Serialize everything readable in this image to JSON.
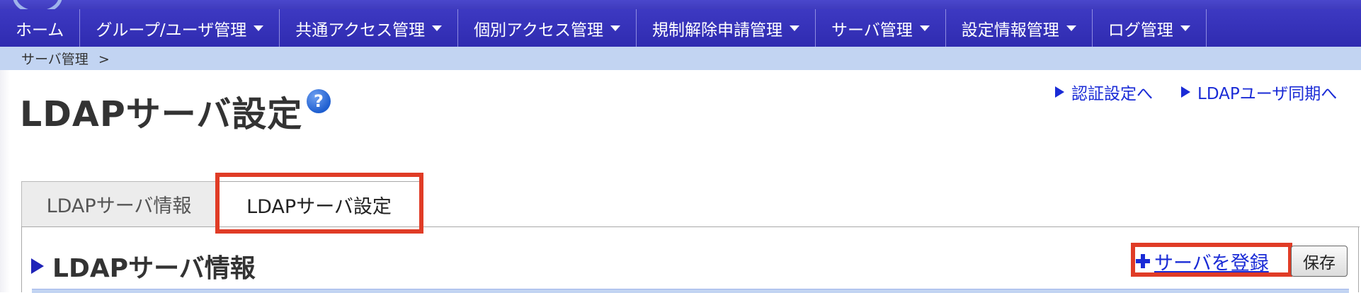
{
  "nav": {
    "items": [
      {
        "label": "ホーム",
        "has_menu": false
      },
      {
        "label": "グループ/ユーザ管理",
        "has_menu": true
      },
      {
        "label": "共通アクセス管理",
        "has_menu": true
      },
      {
        "label": "個別アクセス管理",
        "has_menu": true
      },
      {
        "label": "規制解除申請管理",
        "has_menu": true
      },
      {
        "label": "サーバ管理",
        "has_menu": true
      },
      {
        "label": "設定情報管理",
        "has_menu": true
      },
      {
        "label": "ログ管理",
        "has_menu": true
      }
    ]
  },
  "breadcrumb": {
    "label": "サーバ管理",
    "separator": ">"
  },
  "page": {
    "title": "LDAPサーバ設定",
    "help_icon_glyph": "?"
  },
  "links": {
    "auth_settings": "認証設定へ",
    "ldap_user_sync": "LDAPユーザ同期へ"
  },
  "tabs": [
    {
      "label": "LDAPサーバ情報",
      "active": false
    },
    {
      "label": "LDAPサーバ設定",
      "active": true
    }
  ],
  "section": {
    "title": "LDAPサーバ情報",
    "register_label": "サーバを登録",
    "save_label": "保存"
  },
  "colors": {
    "nav_bg": "#3d39c2",
    "breadcrumb_bg": "#c2d4f2",
    "link": "#1a2bd6",
    "highlight": "#e03c26"
  },
  "icons": {
    "help": "help-icon",
    "triangle": "triangle-right-icon",
    "plus": "plus-icon",
    "caret": "caret-down-icon"
  }
}
